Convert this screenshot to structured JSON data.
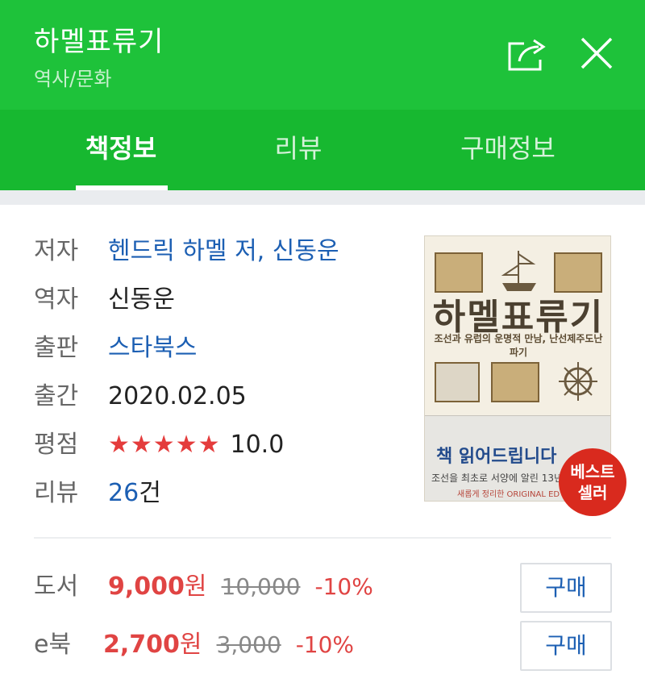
{
  "header": {
    "title": "하멜표류기",
    "category": "역사/문화"
  },
  "tabs": [
    {
      "label": "책정보",
      "active": true
    },
    {
      "label": "리뷰",
      "active": false
    },
    {
      "label": "구매정보",
      "active": false
    }
  ],
  "book_info": {
    "author_label": "저자",
    "author_value": "헨드릭 하멜 저, 신동운",
    "translator_label": "역자",
    "translator_value": "신동운",
    "publisher_label": "출판",
    "publisher_value": "스타북스",
    "date_label": "출간",
    "date_value": "2020.02.05",
    "rating_label": "평점",
    "rating_stars": "★★★★★",
    "rating_value": "10.0",
    "review_label": "리뷰",
    "review_count": "26",
    "review_unit": "건"
  },
  "cover": {
    "title": "하멜표류기",
    "subtitle": "조선과 유럽의 운명적 만남, 난선제주도난파기",
    "band_text": "책 읽어드립니다",
    "band_line": "조선을 최초로 서양에 알린 13년",
    "band_line2": "새롭게 정리한 ORIGINAL ED"
  },
  "badge": {
    "line1": "베스트",
    "line2": "셀러"
  },
  "prices": [
    {
      "label": "도서",
      "price": "9,000",
      "unit": "원",
      "original": "10,000",
      "discount": "-10%",
      "button": "구매"
    },
    {
      "label": "e북",
      "price": "2,700",
      "unit": "원",
      "original": "3,000",
      "discount": "-10%",
      "button": "구매"
    }
  ],
  "colors": {
    "header_green": "#1ec23a",
    "tab_green": "#17b830",
    "link_blue": "#1c5fb3",
    "price_red": "#e04443",
    "star_red": "#e43c3c",
    "badge_red": "#d92a1e"
  },
  "icons": [
    "share-icon",
    "close-icon"
  ]
}
